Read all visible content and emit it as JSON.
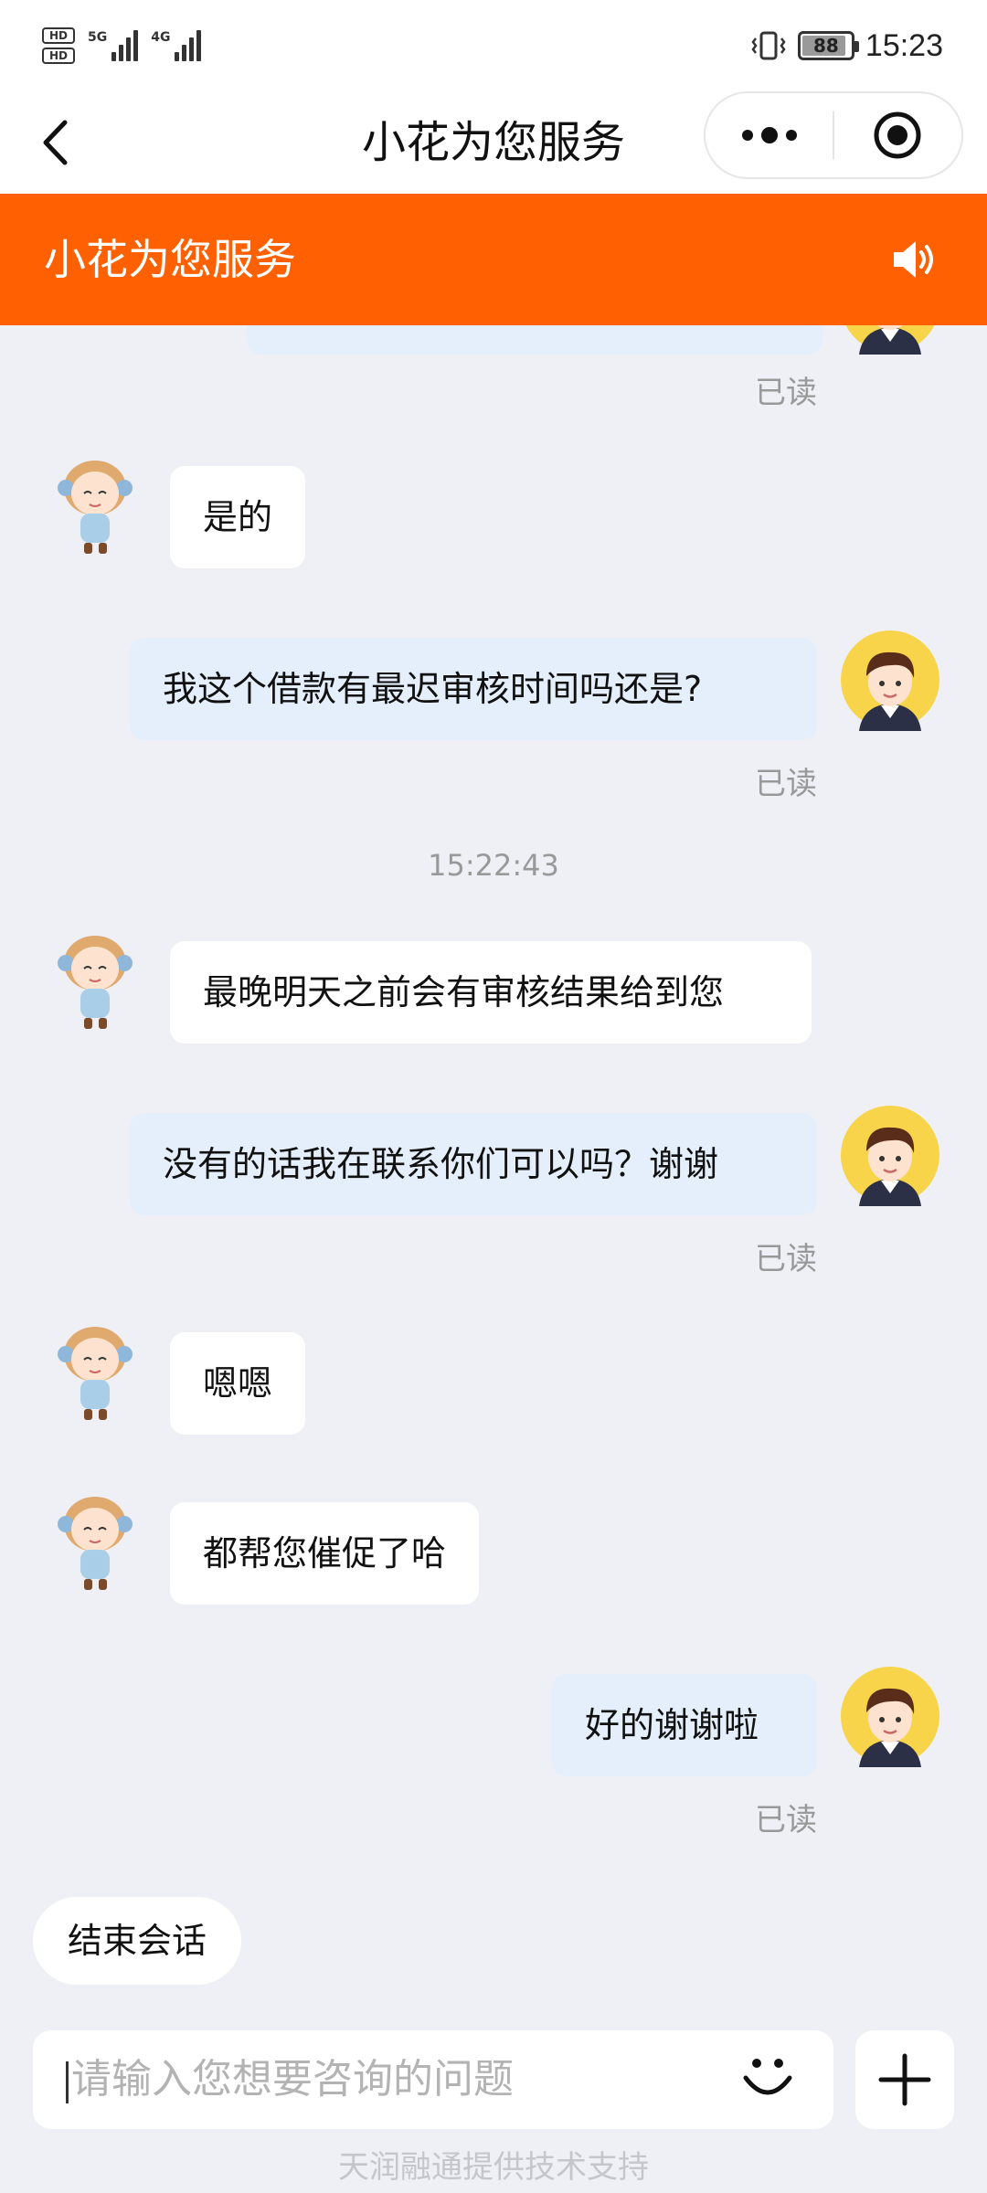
{
  "status_bar": {
    "hd1": "HD",
    "hd2": "HD",
    "net1": "5G",
    "net2": "4G",
    "battery": "88",
    "battery_level": 0.88,
    "time": "15:23"
  },
  "nav": {
    "title": "小花为您服务",
    "icons": {
      "back": "chevron-left-icon",
      "more": "more-dots-icon",
      "close": "target-circle-icon"
    }
  },
  "header": {
    "title": "小花为您服务",
    "icon": "speaker-icon",
    "accent": "#ff6102"
  },
  "chat": {
    "messages": [
      {
        "from": "user",
        "text": "",
        "read": "已读"
      },
      {
        "from": "bot",
        "text": "是的"
      },
      {
        "from": "user",
        "text": "我这个借款有最迟审核时间吗还是?",
        "read": "已读"
      },
      {
        "from": "bot",
        "text": "最晚明天之前会有审核结果给到您"
      },
      {
        "from": "user",
        "text": "没有的话我在联系你们可以吗？谢谢",
        "read": "已读"
      },
      {
        "from": "bot",
        "text": "嗯嗯"
      },
      {
        "from": "bot",
        "text": "都帮您催促了哈"
      },
      {
        "from": "user",
        "text": "好的谢谢啦",
        "read": "已读"
      }
    ],
    "timestamp": "15:22:43",
    "end_session": "结束会话"
  },
  "input": {
    "placeholder": "请输入您想要咨询的问题",
    "emoji_icon": "smile-icon",
    "plus_icon": "plus-icon"
  },
  "footer": "天润融通提供技术支持"
}
